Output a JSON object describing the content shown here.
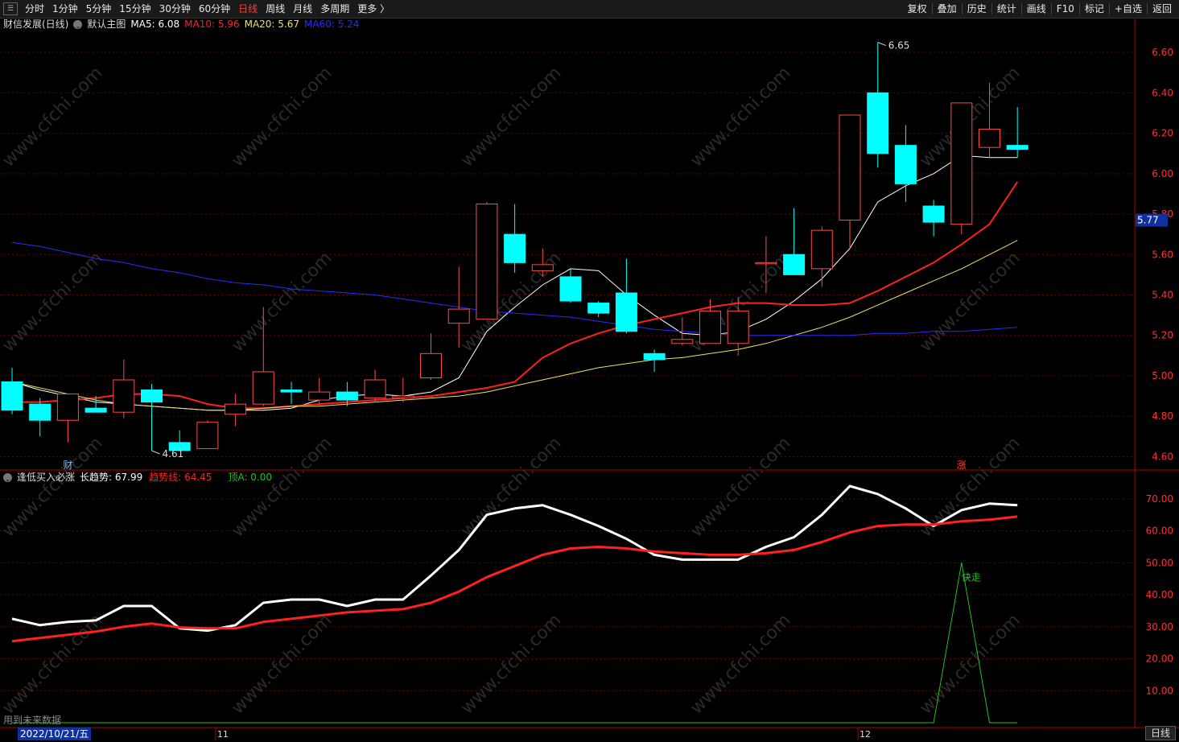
{
  "toolbar": {
    "periods": [
      "分时",
      "1分钟",
      "5分钟",
      "15分钟",
      "30分钟",
      "60分钟",
      "日线",
      "周线",
      "月线",
      "多周期",
      "更多 〉"
    ],
    "active_period": "日线",
    "right_items": [
      "复权",
      "叠加",
      "历史",
      "统计",
      "画线",
      "F10",
      "标记",
      "+自选",
      "返回"
    ]
  },
  "main_info": {
    "title": "财信发展(日线)",
    "template": "默认主图",
    "ma5": "MA5: 6.08",
    "ma10": "MA10: 5.96",
    "ma20": "MA20: 5.67",
    "ma60": "MA60: 5.24"
  },
  "sub_info": {
    "name": "逢低买入必涨",
    "long_trend": "长趋势: 67.99",
    "trend_line": "趋势线: 64.45",
    "top_a": "顶A: 0.00"
  },
  "colors": {
    "up": "#ff4a4a",
    "down": "#00ffff",
    "ma5": "#ffffff",
    "ma10": "#ff2020",
    "ma20": "#f0e060",
    "ma60": "#2a2aff",
    "axis_text": "#ff3030",
    "grid": "#6a0000"
  },
  "chart_data": [
    {
      "type": "candlestick",
      "title": "财信发展(日线)",
      "ylim": [
        4.55,
        6.7
      ],
      "yticks": [
        "6.60",
        "6.40",
        "6.20",
        "6.00",
        "5.80",
        "5.60",
        "5.40",
        "5.20",
        "5.00",
        "4.80",
        "4.60"
      ],
      "current_price": "5.77",
      "high_label": "6.65",
      "low_label": "4.61",
      "markers": [
        {
          "text": "财",
          "index": 2
        },
        {
          "text": "涨",
          "index": 34
        }
      ],
      "candles": [
        {
          "o": 4.97,
          "h": 5.04,
          "l": 4.81,
          "c": 4.83
        },
        {
          "o": 4.86,
          "h": 4.89,
          "l": 4.7,
          "c": 4.78
        },
        {
          "o": 4.78,
          "h": 4.89,
          "l": 4.67,
          "c": 4.91
        },
        {
          "o": 4.84,
          "h": 4.9,
          "l": 4.82,
          "c": 4.82
        },
        {
          "o": 4.82,
          "h": 5.08,
          "l": 4.79,
          "c": 4.98
        },
        {
          "o": 4.93,
          "h": 4.96,
          "l": 4.63,
          "c": 4.87
        },
        {
          "o": 4.67,
          "h": 4.73,
          "l": 4.63,
          "c": 4.63
        },
        {
          "o": 4.64,
          "h": 4.78,
          "l": 4.64,
          "c": 4.77
        },
        {
          "o": 4.81,
          "h": 4.91,
          "l": 4.75,
          "c": 4.86
        },
        {
          "o": 4.86,
          "h": 5.34,
          "l": 4.85,
          "c": 5.02
        },
        {
          "o": 4.93,
          "h": 4.97,
          "l": 4.86,
          "c": 4.92
        },
        {
          "o": 4.88,
          "h": 4.99,
          "l": 4.86,
          "c": 4.92
        },
        {
          "o": 4.92,
          "h": 4.97,
          "l": 4.85,
          "c": 4.88
        },
        {
          "o": 4.89,
          "h": 5.03,
          "l": 4.87,
          "c": 4.98
        },
        {
          "o": 4.89,
          "h": 4.99,
          "l": 4.87,
          "c": 4.9
        },
        {
          "o": 4.99,
          "h": 5.21,
          "l": 4.98,
          "c": 5.11
        },
        {
          "o": 5.26,
          "h": 5.54,
          "l": 5.14,
          "c": 5.33
        },
        {
          "o": 5.28,
          "h": 5.86,
          "l": 5.28,
          "c": 5.85
        },
        {
          "o": 5.7,
          "h": 5.85,
          "l": 5.51,
          "c": 5.56
        },
        {
          "o": 5.52,
          "h": 5.63,
          "l": 5.49,
          "c": 5.55
        },
        {
          "o": 5.49,
          "h": 5.53,
          "l": 5.36,
          "c": 5.37
        },
        {
          "o": 5.36,
          "h": 5.37,
          "l": 5.29,
          "c": 5.31
        },
        {
          "o": 5.41,
          "h": 5.58,
          "l": 5.21,
          "c": 5.22
        },
        {
          "o": 5.11,
          "h": 5.13,
          "l": 5.02,
          "c": 5.08
        },
        {
          "o": 5.16,
          "h": 5.29,
          "l": 5.15,
          "c": 5.18
        },
        {
          "o": 5.16,
          "h": 5.38,
          "l": 5.16,
          "c": 5.32
        },
        {
          "o": 5.16,
          "h": 5.39,
          "l": 5.1,
          "c": 5.32
        },
        {
          "o": 5.56,
          "h": 5.69,
          "l": 5.41,
          "c": 5.56
        },
        {
          "o": 5.6,
          "h": 5.83,
          "l": 5.5,
          "c": 5.5
        },
        {
          "o": 5.53,
          "h": 5.74,
          "l": 5.44,
          "c": 5.72
        },
        {
          "o": 5.77,
          "h": 6.01,
          "l": 5.63,
          "c": 6.29
        },
        {
          "o": 6.4,
          "h": 6.65,
          "l": 6.03,
          "c": 6.1
        },
        {
          "o": 6.14,
          "h": 6.24,
          "l": 5.86,
          "c": 5.95
        },
        {
          "o": 5.84,
          "h": 5.87,
          "l": 5.69,
          "c": 5.76
        },
        {
          "o": 5.75,
          "h": 6.35,
          "l": 5.7,
          "c": 6.35
        },
        {
          "o": 6.13,
          "h": 6.45,
          "l": 6.08,
          "c": 6.22
        },
        {
          "o": 6.14,
          "h": 6.33,
          "l": 6.08,
          "c": 6.12
        }
      ],
      "series": [
        {
          "name": "MA5",
          "values": [
            4.97,
            4.93,
            4.9,
            4.87,
            4.86,
            4.85,
            4.84,
            4.83,
            4.83,
            4.83,
            4.84,
            4.88,
            4.9,
            4.91,
            4.9,
            4.92,
            4.99,
            5.22,
            5.34,
            5.45,
            5.53,
            5.52,
            5.4,
            5.3,
            5.21,
            5.2,
            5.22,
            5.28,
            5.37,
            5.48,
            5.63,
            5.86,
            5.94,
            6.0,
            6.09,
            6.08,
            6.08
          ]
        },
        {
          "name": "MA10",
          "values": [
            4.87,
            4.87,
            4.88,
            4.89,
            4.91,
            4.91,
            4.9,
            4.86,
            4.84,
            4.84,
            4.85,
            4.86,
            4.87,
            4.88,
            4.89,
            4.9,
            4.92,
            4.94,
            4.97,
            5.09,
            5.16,
            5.21,
            5.25,
            5.28,
            5.31,
            5.34,
            5.36,
            5.36,
            5.35,
            5.35,
            5.36,
            5.42,
            5.49,
            5.56,
            5.65,
            5.75,
            5.96
          ]
        },
        {
          "name": "MA20",
          "values": [
            4.97,
            4.94,
            4.91,
            4.88,
            4.86,
            4.85,
            4.84,
            4.83,
            4.83,
            4.84,
            4.85,
            4.85,
            4.86,
            4.87,
            4.88,
            4.89,
            4.9,
            4.92,
            4.95,
            4.98,
            5.01,
            5.04,
            5.06,
            5.08,
            5.09,
            5.11,
            5.13,
            5.16,
            5.2,
            5.24,
            5.29,
            5.35,
            5.41,
            5.47,
            5.53,
            5.6,
            5.67
          ]
        },
        {
          "name": "MA60",
          "values": [
            5.66,
            5.64,
            5.61,
            5.58,
            5.56,
            5.53,
            5.51,
            5.48,
            5.46,
            5.45,
            5.43,
            5.42,
            5.41,
            5.4,
            5.38,
            5.36,
            5.34,
            5.32,
            5.31,
            5.3,
            5.29,
            5.27,
            5.25,
            5.23,
            5.22,
            5.21,
            5.2,
            5.2,
            5.2,
            5.2,
            5.2,
            5.21,
            5.21,
            5.22,
            5.22,
            5.23,
            5.24
          ]
        }
      ]
    },
    {
      "type": "line",
      "title": "逢低买入必涨",
      "ylim": [
        0,
        75
      ],
      "yticks": [
        "70.00",
        "60.00",
        "50.00",
        "40.00",
        "30.00",
        "20.00",
        "10.00"
      ],
      "annotation": {
        "text": "快走",
        "index": 34
      },
      "series": [
        {
          "name": "长趋势",
          "color": "#ffffff",
          "values": [
            32.5,
            30.5,
            31.5,
            32,
            36.5,
            36.5,
            29.5,
            28.8,
            30.5,
            37.5,
            38.5,
            38.5,
            36.5,
            38.5,
            38.5,
            46,
            54,
            65,
            67,
            68,
            65,
            61.5,
            57.5,
            52.5,
            51,
            51,
            51,
            55,
            58,
            65,
            74,
            71.5,
            67,
            61.5,
            66.5,
            68.5,
            68
          ]
        },
        {
          "name": "趋势线",
          "color": "#ff2020",
          "values": [
            25.5,
            26.5,
            27.5,
            28.5,
            30,
            31,
            29.8,
            29.5,
            29.5,
            31.5,
            32.5,
            33.5,
            34.5,
            35,
            35.5,
            37.5,
            41,
            45.5,
            49,
            52.5,
            54.5,
            55,
            54.5,
            53.5,
            53,
            52.5,
            52.5,
            53,
            54,
            56.5,
            59.5,
            61.5,
            62,
            62,
            63,
            63.5,
            64.45
          ]
        },
        {
          "name": "顶A",
          "color": "#20c020",
          "values": [
            0,
            0,
            0,
            0,
            0,
            0,
            0,
            0,
            0,
            0,
            0,
            0,
            0,
            0,
            0,
            0,
            0,
            0,
            0,
            0,
            0,
            0,
            0,
            0,
            0,
            0,
            0,
            0,
            0,
            0,
            0,
            0,
            0,
            0,
            50,
            0,
            0
          ]
        }
      ]
    }
  ],
  "x_axis": {
    "date_label": "2022/10/21/五",
    "month_labels": [
      {
        "text": "11",
        "index": 7
      },
      {
        "text": "12",
        "index": 30
      }
    ],
    "period_button": "日线"
  },
  "notes": {
    "future_data": "用到未来数据"
  },
  "watermark": "www.cfchi.com"
}
